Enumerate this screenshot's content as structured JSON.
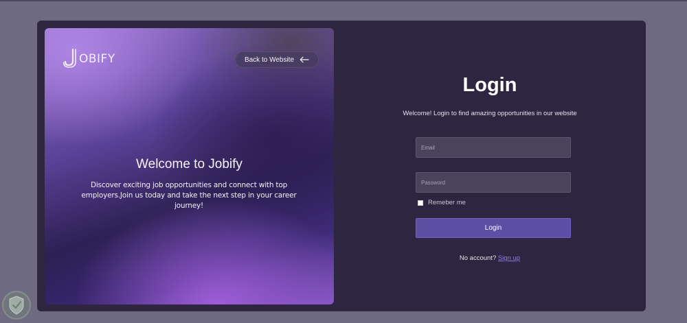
{
  "brand": {
    "logo_text": "OBIFY"
  },
  "hero": {
    "back_button_label": "Back to Website",
    "title": "Welcome to Jobify",
    "description": "Discover exciting job opportunities and connect with top employers.Join us today and take the next step in your career journey!"
  },
  "login": {
    "title": "Login",
    "subtitle": "Welcome! Login to find amazing opportunities in our website",
    "email_placeholder": "Email",
    "email_value": "",
    "password_placeholder": "Password",
    "password_value": "",
    "remember_label": "Remeber me",
    "remember_checked": false,
    "submit_label": "Login",
    "no_account_text": "No account?",
    "signup_link": "Sign up"
  },
  "icons": {
    "logo": "j-logo-icon",
    "back": "arrow-left-icon",
    "badge": "shield-check-icon"
  },
  "colors": {
    "page_bg": "#6e6a80",
    "card_bg": "#2e2640",
    "input_bg": "#4a435c",
    "button_bg": "#5d4ea6",
    "link": "#8c7fe0"
  }
}
